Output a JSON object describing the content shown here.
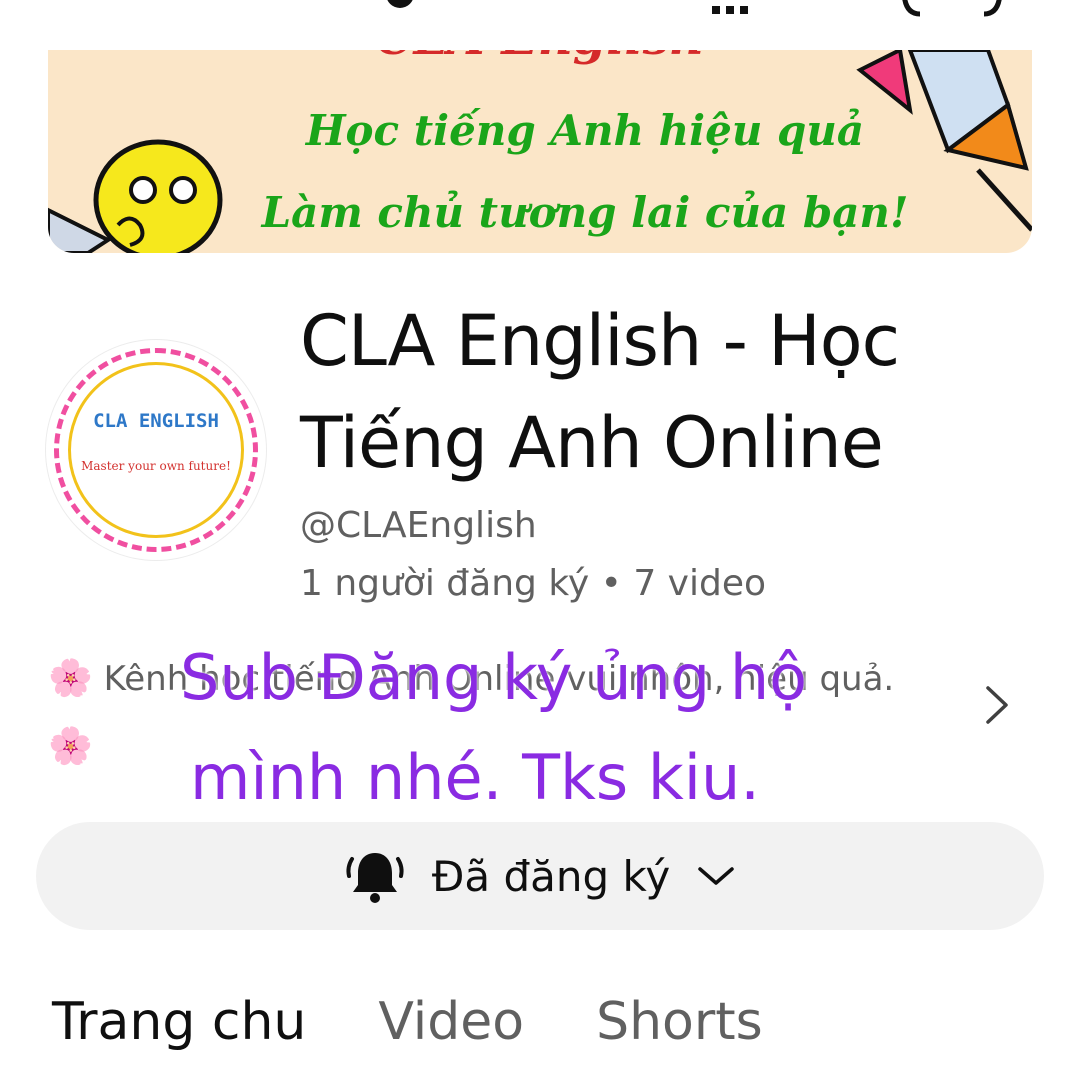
{
  "banner": {
    "top_text": "CLA English",
    "line1": "Học tiếng Anh hiệu quả",
    "line2": "Làm chủ tương lai của bạn!"
  },
  "avatar": {
    "title": "CLA ENGLISH",
    "subtitle": "Master your own future!"
  },
  "channel": {
    "name": "CLA English - Học Tiếng Anh Online",
    "handle": "@CLAEnglish",
    "stats": "1 người đăng ký • 7 video"
  },
  "description": {
    "flower": "🌸",
    "text_before": "Kênh học tiếng Anh Online vui nhộn, hiệu quả.",
    "chevron_icon": "chevron-right-icon"
  },
  "overlay": {
    "line1": "Sub Đăng ký ủng hộ",
    "line2": "mình nhé.  Tks kiu.",
    "color": "#8a2be2"
  },
  "subscribe_button": {
    "label": "Đã đăng ký",
    "bell_icon": "bell-icon",
    "chevron_icon": "chevron-down-icon"
  },
  "tabs": [
    {
      "label": "Trang chu",
      "active": true
    },
    {
      "label": "Video",
      "active": false
    },
    {
      "label": "Shorts",
      "active": false
    }
  ]
}
